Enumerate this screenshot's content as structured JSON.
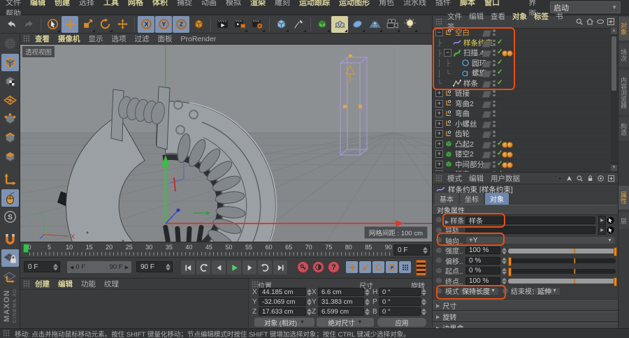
{
  "colors": {
    "accent_orange": "#e8882a",
    "annotation": "#e84e12",
    "active_blue": "#7e93b4",
    "check_green": "#6fc043",
    "axis_red": "#e03828",
    "axis_green": "#2fc53a",
    "selection_violet": "#a79ae0",
    "menu_highlight": "#d9d298"
  },
  "menubar": {
    "items": [
      {
        "label": "文件",
        "hl": false
      },
      {
        "label": "编辑",
        "hl": true
      },
      {
        "label": "创建",
        "hl": true
      },
      {
        "label": "选择",
        "hl": false
      },
      {
        "label": "工具",
        "hl": true
      },
      {
        "label": "网格",
        "hl": true
      },
      {
        "label": "体积",
        "hl": true
      },
      {
        "label": "捕捉",
        "hl": false
      },
      {
        "label": "动画",
        "hl": false
      },
      {
        "label": "模拟",
        "hl": false
      },
      {
        "label": "渲染",
        "hl": true
      },
      {
        "label": "雕刻",
        "hl": false
      },
      {
        "label": "运动跟踪",
        "hl": true
      },
      {
        "label": "运动图形",
        "hl": true
      },
      {
        "label": "角色",
        "hl": false
      },
      {
        "label": "流水线",
        "hl": false
      },
      {
        "label": "插件",
        "hl": false
      },
      {
        "label": "脚本",
        "hl": true
      },
      {
        "label": "窗口",
        "hl": true
      },
      {
        "label": "帮助",
        "hl": false
      }
    ],
    "interface_label": "界面:",
    "interface_value": "启动"
  },
  "main_toolbar": {
    "icons": [
      {
        "name": "undo",
        "icon": "undo"
      },
      {
        "name": "redo",
        "icon": "redo",
        "dim": true
      },
      {
        "divider": true
      },
      {
        "name": "live-select",
        "icon": "select",
        "fly": true
      },
      {
        "name": "move",
        "icon": "move",
        "bg": "blue"
      },
      {
        "name": "scale",
        "icon": "scale",
        "fly": true
      },
      {
        "name": "rotate",
        "icon": "rotate",
        "fly": true
      },
      {
        "name": "last-tool",
        "icon": "move"
      },
      {
        "divider": true
      },
      {
        "name": "lock-x",
        "icon": "lockx",
        "bg": "blue"
      },
      {
        "name": "lock-y",
        "icon": "locky",
        "bg": "blue"
      },
      {
        "name": "lock-z",
        "icon": "lockz",
        "bg": "blue"
      },
      {
        "name": "coord-system",
        "icon": "coordsys"
      },
      {
        "divider": true
      },
      {
        "name": "render-view",
        "icon": "renderview"
      },
      {
        "name": "render-picture-viewer",
        "icon": "renderpv",
        "fly": true
      },
      {
        "name": "render-settings",
        "icon": "renderset",
        "fly": true
      },
      {
        "divider": true
      },
      {
        "name": "add-primitive",
        "icon": "cubeblue",
        "fly": true
      },
      {
        "name": "add-spline",
        "icon": "pen",
        "fly": true
      },
      {
        "divider": true
      },
      {
        "name": "subdivision-surface",
        "icon": "subdiv",
        "fly": true
      },
      {
        "name": "generators",
        "icon": "generator",
        "bg": "yellow",
        "fly": true
      },
      {
        "name": "deformers",
        "icon": "deformer",
        "fly": true
      },
      {
        "name": "floor-objects",
        "icon": "floor",
        "fly": true
      },
      {
        "name": "camera-objects",
        "icon": "camera",
        "fly": true
      },
      {
        "name": "light-objects",
        "icon": "light",
        "fly": true
      }
    ]
  },
  "mode_toolbar": {
    "icons": [
      {
        "name": "make-editable",
        "icon": "editable",
        "dim": true
      },
      {
        "name": "model-mode",
        "icon": "modelmode",
        "bg": "blue"
      },
      {
        "name": "texture-mode",
        "icon": "texturemode"
      },
      {
        "name": "workplane-mode",
        "icon": "workplane"
      },
      {
        "name": "points-mode",
        "icon": "pointsmode"
      },
      {
        "name": "edges-mode",
        "icon": "edgesmode"
      },
      {
        "name": "polygons-mode",
        "icon": "polysmode"
      },
      {
        "gap": true
      },
      {
        "name": "axis-mode",
        "icon": "axismode"
      },
      {
        "name": "snap-toggle",
        "icon": "mouse",
        "bg": "blue"
      },
      {
        "name": "solo-mode",
        "icon": "solo"
      },
      {
        "gap": true
      },
      {
        "name": "magnet-move",
        "icon": "magnet"
      },
      {
        "name": "workplane-lock",
        "icon": "wplock",
        "bg": "blue"
      },
      {
        "name": "workplane-axes",
        "icon": "wpaxes"
      }
    ],
    "logo_line1": "MAXON",
    "logo_line2": "CINEMA 4D"
  },
  "viewport": {
    "menu": [
      {
        "label": "查看",
        "hl": true
      },
      {
        "label": "摄像机",
        "hl": true
      },
      {
        "label": "显示",
        "hl": false
      },
      {
        "label": "选项",
        "hl": false
      },
      {
        "label": "过滤",
        "hl": false
      },
      {
        "label": "面板",
        "hl": false
      },
      {
        "label": "ProRender",
        "hl": false
      }
    ],
    "view_label": "透视视图",
    "grid_label": "网格间距 : 100 cm",
    "axis_y": "Y",
    "axis_x": "X"
  },
  "object_manager": {
    "menu": [
      {
        "label": "文件",
        "hl": false
      },
      {
        "label": "编辑",
        "hl": false
      },
      {
        "label": "查看",
        "hl": false
      },
      {
        "label": "对象",
        "hl": true
      },
      {
        "label": "标签",
        "hl": true
      },
      {
        "label": "书签",
        "hl": false
      }
    ],
    "header_icons": [
      "search",
      "home",
      "filter-eye",
      "add-panel"
    ],
    "objects": [
      {
        "name": "空白",
        "icon": "null",
        "tree": "",
        "exp": "-",
        "color": "#e8a33c",
        "check": false,
        "tags": 0
      },
      {
        "name": "样条约束",
        "icon": "constraint",
        "tree": "├",
        "exp": "",
        "color": "#ead84e",
        "check": true,
        "tags": 0
      },
      {
        "name": "扫描.4",
        "icon": "sweep",
        "tree": "├",
        "exp": "-",
        "color": "#c8c8c8",
        "check": true,
        "tags": 2
      },
      {
        "name": "圆环",
        "icon": "circle",
        "tree": "│├",
        "exp": "",
        "color": "#c8c8c8",
        "check": true,
        "tags": 0
      },
      {
        "name": "螺旋",
        "icon": "helix",
        "tree": "│└",
        "exp": "",
        "color": "#c8c8c8",
        "check": true,
        "tags": 0
      },
      {
        "name": "样条",
        "icon": "spline",
        "tree": "└",
        "exp": "",
        "color": "#c8c8c8",
        "check": true,
        "tags": 0
      },
      {
        "name": "链接",
        "icon": "null",
        "tree": "",
        "exp": "+",
        "color": "#c8c8c8",
        "check": false,
        "tags": 0
      },
      {
        "name": "弯曲2",
        "icon": "null",
        "tree": "",
        "exp": "+",
        "color": "#c8c8c8",
        "check": false,
        "tags": 0
      },
      {
        "name": "弯曲",
        "icon": "null",
        "tree": "",
        "exp": "+",
        "color": "#c8c8c8",
        "check": false,
        "tags": 0
      },
      {
        "name": "小螺丝",
        "icon": "null",
        "tree": "",
        "exp": "+",
        "color": "#c8c8c8",
        "check": false,
        "tags": 0
      },
      {
        "name": "齿轮",
        "icon": "null",
        "tree": "",
        "exp": "+",
        "color": "#c8c8c8",
        "check": false,
        "tags": 0
      },
      {
        "name": "凸起2",
        "icon": "cubegreen",
        "tree": "",
        "exp": "+",
        "color": "#c8c8c8",
        "check": true,
        "tags": 2
      },
      {
        "name": "镂空2",
        "icon": "cubegreen",
        "tree": "",
        "exp": "+",
        "color": "#c8c8c8",
        "check": true,
        "tags": 2
      },
      {
        "name": "中间部分",
        "icon": "cubegreen",
        "tree": "",
        "exp": "+",
        "color": "#c8c8c8",
        "check": true,
        "tags": 2
      },
      {
        "name": "镂空",
        "icon": "cubegreen",
        "tree": "",
        "exp": "+",
        "color": "#c8c8c8",
        "check": true,
        "tags": 2
      }
    ]
  },
  "side_tabs": {
    "top": [
      {
        "label": "对象",
        "active": true
      },
      {
        "label": "场次",
        "active": false
      },
      {
        "label": "内容浏览器",
        "active": false
      },
      {
        "label": "构造",
        "active": false
      }
    ],
    "bottom": [
      {
        "label": "属性",
        "active": true
      },
      {
        "label": "层",
        "active": false
      }
    ]
  },
  "attributes": {
    "menu": [
      "模式",
      "编辑",
      "用户数据"
    ],
    "header_icons": [
      "history-back",
      "history-up",
      "search",
      "lock",
      "target",
      "add-panel"
    ],
    "title": "样条约束 [样条约束]",
    "tabs": [
      {
        "label": "基本",
        "active": false
      },
      {
        "label": "坐标",
        "active": false
      },
      {
        "label": "对象",
        "active": true
      }
    ],
    "section": "对象属性",
    "params": [
      {
        "label": "样条",
        "type": "link",
        "value": "样条",
        "expand": true,
        "icon": "splineblue"
      },
      {
        "label": "导轨..",
        "type": "link",
        "value": "",
        "expand": false
      },
      {
        "label": "轴向..",
        "type": "dropdown",
        "value": "+Y"
      },
      {
        "label": "强度..",
        "type": "slider",
        "value": "100 %",
        "fill": 100
      },
      {
        "label": "偏移..",
        "type": "slider",
        "value": "0 %",
        "fill": 0
      },
      {
        "label": "起点..",
        "type": "slider",
        "value": "0 %",
        "fill": 0
      },
      {
        "label": "终点..",
        "type": "slider",
        "value": "100 %",
        "fill": 100
      },
      {
        "label": "模式",
        "type": "dual",
        "value": "保持长度",
        "label2": "结束模式",
        "value2": "延伸"
      }
    ],
    "sections": [
      "尺寸",
      "旋转",
      "边界盒"
    ]
  },
  "timeline": {
    "ticks": [
      0,
      5,
      10,
      15,
      20,
      25,
      30,
      35,
      40,
      45,
      50,
      55,
      60,
      65,
      70,
      75,
      80,
      85,
      90
    ],
    "current_frame": "0 F",
    "range_start": "0 F",
    "range_end": "90 F",
    "end_frame": "90 F",
    "transport": [
      "jump-start",
      "prev-key",
      "prev-frame",
      "play",
      "next-frame",
      "next-key",
      "jump-end"
    ],
    "record_buttons": [
      "record-keyframe",
      "autokey-toggle",
      "keyframe-options"
    ],
    "key_toggles": [
      "key-position",
      "key-scale",
      "key-rotation",
      "key-parameter",
      "key-pla"
    ]
  },
  "materials": {
    "menu": [
      {
        "label": "创建",
        "hl": true
      },
      {
        "label": "编辑",
        "hl": true
      },
      {
        "label": "功能",
        "hl": false
      },
      {
        "label": "纹理",
        "hl": false
      }
    ]
  },
  "coordinates": {
    "headers": [
      "位置",
      "尺寸",
      "旋转"
    ],
    "position": [
      {
        "a": "X",
        "v": "44.185 cm"
      },
      {
        "a": "Y",
        "v": "-32.069 cm"
      },
      {
        "a": "Z",
        "v": "17.633 cm"
      }
    ],
    "size": [
      {
        "a": "X",
        "v": "6.6 cm"
      },
      {
        "a": "Y",
        "v": "31.383 cm"
      },
      {
        "a": "Z",
        "v": "6.599 cm"
      }
    ],
    "rotation": [
      {
        "a": "H",
        "v": "0 °"
      },
      {
        "a": "P",
        "v": "0 °"
      },
      {
        "a": "B",
        "v": "0 °"
      }
    ],
    "mode_object": "对象 (相对)",
    "mode_size": "绝对尺寸",
    "apply": "应用"
  },
  "status_bar": {
    "text": "移动: 点击并拖动鼠标移动元素。按住 SHIFT 键量化移动；节点编辑模式时按住 SHIFT 键增加选择对象；按住 CTRL 键减少选择对象。"
  }
}
